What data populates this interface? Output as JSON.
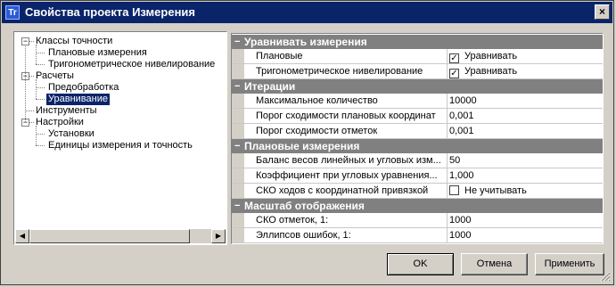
{
  "window": {
    "app_icon": "Tr",
    "title": "Свойства проекта Измерения",
    "close_glyph": "×"
  },
  "tree": {
    "toggles": {
      "expanded": "−"
    },
    "items": [
      {
        "label": "Классы точности",
        "level": 0,
        "expanded": true
      },
      {
        "label": "Плановые измерения",
        "level": 1
      },
      {
        "label": "Тригонометрическое нивелирование",
        "level": 1
      },
      {
        "label": "Расчеты",
        "level": 0,
        "expanded": true
      },
      {
        "label": "Предобработка",
        "level": 1
      },
      {
        "label": "Уравнивание",
        "level": 1,
        "selected": true
      },
      {
        "label": "Инструменты",
        "level": 0
      },
      {
        "label": "Настройки",
        "level": 0,
        "expanded": true
      },
      {
        "label": "Установки",
        "level": 1
      },
      {
        "label": "Единицы измерения и точность",
        "level": 1
      }
    ],
    "scrollbar": {
      "left_arrow": "◀",
      "right_arrow": "▶"
    }
  },
  "grid": {
    "collapse_glyph": "−",
    "check_glyph": "✓",
    "categories": [
      {
        "label": "Уравнивать измерения",
        "rows": [
          {
            "name": "Плановые",
            "value": "Уравнивать",
            "checked": true
          },
          {
            "name": "Тригонометрическое нивелирование",
            "value": "Уравнивать",
            "checked": true
          }
        ]
      },
      {
        "label": "Итерации",
        "rows": [
          {
            "name": "Максимальное количество",
            "value": "10000"
          },
          {
            "name": "Порог сходимости плановых координат",
            "value": "0,001"
          },
          {
            "name": "Порог сходимости отметок",
            "value": "0,001"
          }
        ]
      },
      {
        "label": "Плановые измерения",
        "rows": [
          {
            "name": "Баланс весов линейных и угловых изм...",
            "value": "50"
          },
          {
            "name": "Коэффициент при угловых уравнения...",
            "value": "1,000"
          },
          {
            "name": "СКО ходов с координатной привязкой",
            "value": "Не учитывать",
            "checked": false
          }
        ]
      },
      {
        "label": "Масштаб отображения",
        "rows": [
          {
            "name": "СКО отметок, 1:",
            "value": "1000"
          },
          {
            "name": "Эллипсов ошибок, 1:",
            "value": "1000"
          }
        ]
      }
    ]
  },
  "buttons": {
    "ok": "OK",
    "cancel": "Отмена",
    "apply": "Применить"
  }
}
